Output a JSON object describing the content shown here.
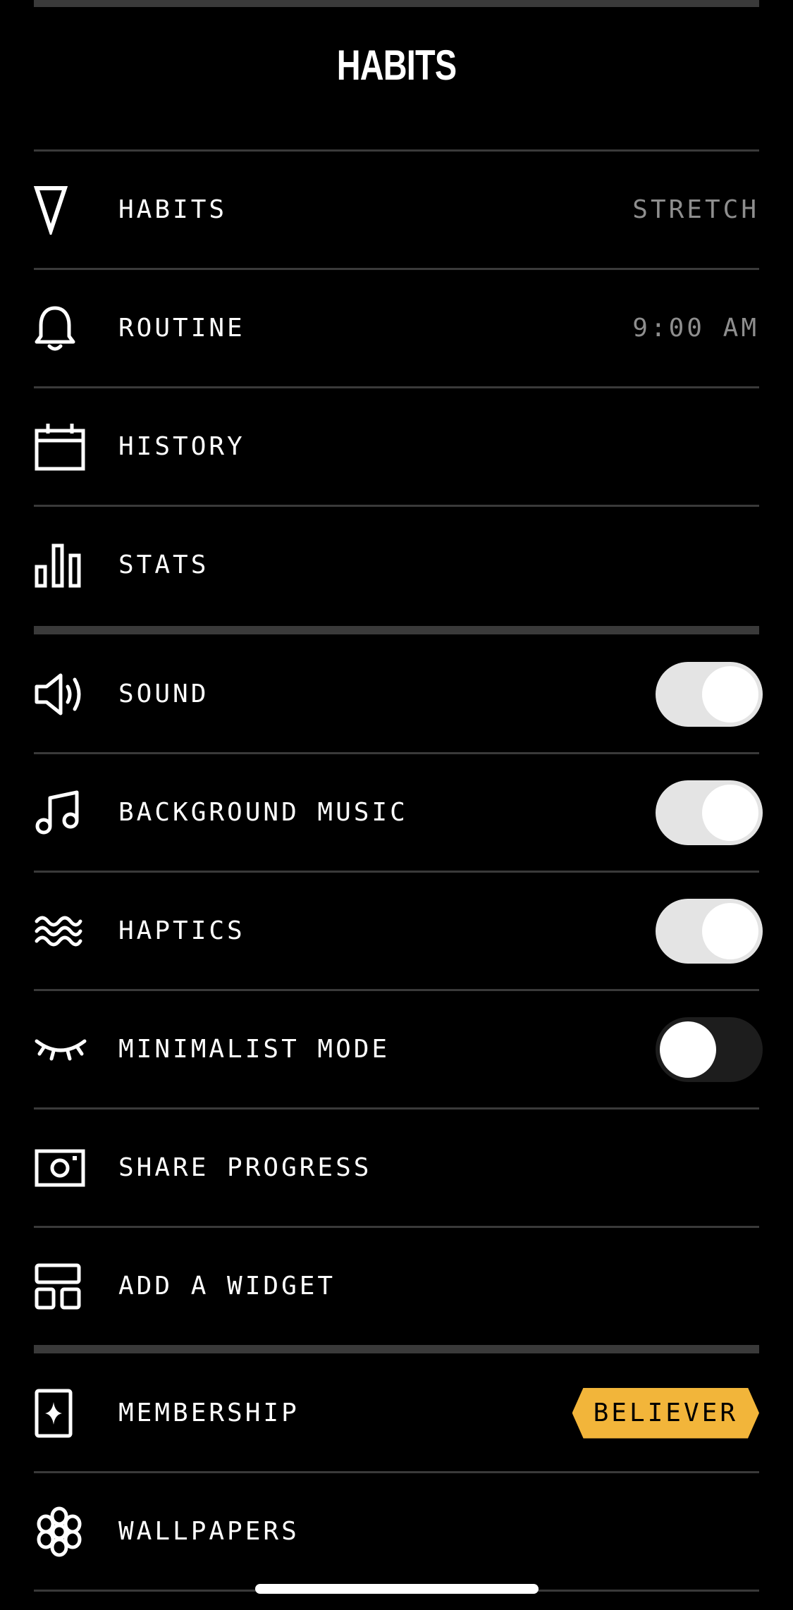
{
  "header": {
    "title": "HABITS"
  },
  "rows": [
    {
      "label": "HABITS",
      "value": "STRETCH",
      "icon": "triangle-down-icon"
    },
    {
      "label": "ROUTINE",
      "value": "9:00 AM",
      "icon": "bell-icon"
    },
    {
      "label": "HISTORY",
      "icon": "calendar-icon"
    },
    {
      "label": "STATS",
      "icon": "bar-chart-icon"
    },
    {
      "label": "SOUND",
      "icon": "speaker-icon",
      "toggle": true
    },
    {
      "label": "BACKGROUND MUSIC",
      "icon": "music-note-icon",
      "toggle": true
    },
    {
      "label": "HAPTICS",
      "icon": "waves-icon",
      "toggle": true
    },
    {
      "label": "MINIMALIST MODE",
      "icon": "closed-eye-icon",
      "toggle": false
    },
    {
      "label": "SHARE PROGRESS",
      "icon": "camera-icon"
    },
    {
      "label": "ADD A WIDGET",
      "icon": "widget-grid-icon"
    },
    {
      "label": "MEMBERSHIP",
      "value": "BELIEVER",
      "icon": "membership-card-icon"
    },
    {
      "label": "WALLPAPERS",
      "icon": "flower-icon"
    }
  ],
  "colors": {
    "background": "#000000",
    "divider": "#3a3a3a",
    "badge": "#f2b53a",
    "value_text": "#8e8e8e"
  }
}
